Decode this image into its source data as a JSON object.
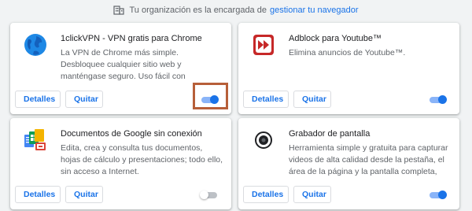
{
  "managed_notice": {
    "text": "Tu organización es la encargada de",
    "link": "gestionar tu navegador",
    "icon": "building-icon"
  },
  "buttons": {
    "details": "Detalles",
    "remove": "Quitar"
  },
  "colors": {
    "accent": "#1a73e8",
    "highlight_box": "#b75f39"
  },
  "extensions": [
    {
      "name": "1clickVPN - VPN gratis para Chrome",
      "description": "La VPN de Chrome más simple. Desbloquee cualquier sitio web y manténgase seguro. Uso fácil con activación con un clic. Ilimitado y",
      "icon": "globe-icon",
      "enabled": true
    },
    {
      "name": "Adblock para Youtube™",
      "description": "Elimina anuncios de Youtube™.",
      "icon": "fast-forward-icon",
      "enabled": true
    },
    {
      "name": "Documentos de Google sin conexión",
      "description": "Edita, crea y consulta tus documentos, hojas de cálculo y presentaciones; todo ello, sin acceso a Internet.",
      "icon": "google-docs-icon",
      "enabled": false
    },
    {
      "name": "Grabador de pantalla",
      "description": "Herramienta simple y gratuita para capturar videos de alta calidad desde la pestaña, el área de la página y la pantalla completa, con",
      "icon": "record-icon",
      "enabled": true
    }
  ]
}
